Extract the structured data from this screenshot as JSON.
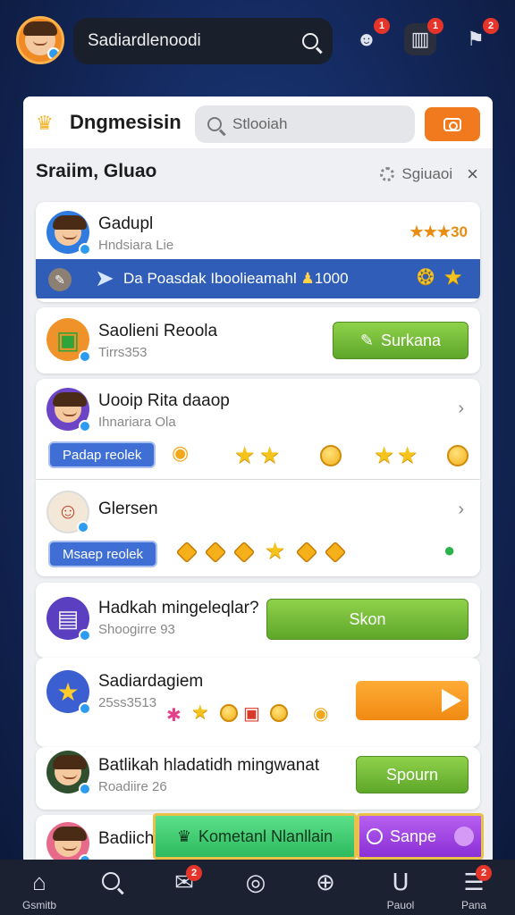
{
  "top": {
    "search_value": "Sadiardlenoodi",
    "badges": [
      "1",
      "1",
      "2"
    ]
  },
  "panel": {
    "title": "Dngmesisin",
    "search_placeholder": "Stlooiah",
    "sub_title": "Sraiim, Gluao",
    "sub_right": "Sgiuaoi"
  },
  "cards": [
    {
      "name": "Gadupl",
      "sub": "Hndsiara Lie",
      "rank": "★★★30",
      "strip_text": "Da Poasdak Iboolieamahl",
      "strip_number": "1000"
    },
    {
      "name": "Saolieni Reoola",
      "sub": "Tirrs353",
      "button": "Surkana"
    },
    {
      "name": "Uooip Rita daaop",
      "sub": "Ihnariara Ola",
      "pill": "Padap reolek"
    },
    {
      "name": "Glersen",
      "pill": "Msaep reolek"
    },
    {
      "name": "Hadkah mingeleqlar?",
      "sub": "Shoogirre 93",
      "button": "Skon"
    },
    {
      "name": "Sadiardagiem",
      "sub": "25ss3513"
    },
    {
      "name": "Batlikah hladatidh mingwanat",
      "sub": "Roadiire 26",
      "button": "Spourn"
    },
    {
      "name": "Badiich"
    }
  ],
  "actions": {
    "green": "Kometanl Nlanllain",
    "purple": "Sanpe"
  },
  "nav": [
    {
      "label": "Gsmitb",
      "icon": "home-icon"
    },
    {
      "label": "",
      "icon": "search-icon"
    },
    {
      "label": "",
      "icon": "mail-icon",
      "badge": "2"
    },
    {
      "label": "",
      "icon": "chat-icon"
    },
    {
      "label": "",
      "icon": "globe-icon"
    },
    {
      "label": "Pauol",
      "icon": "magnet-icon"
    },
    {
      "label": "Pana",
      "icon": "menu-icon",
      "badge": "2"
    }
  ],
  "colors": {
    "accent_orange": "#f07a1d",
    "accent_green": "#5ea72a",
    "strip_blue": "#2f5db8"
  }
}
